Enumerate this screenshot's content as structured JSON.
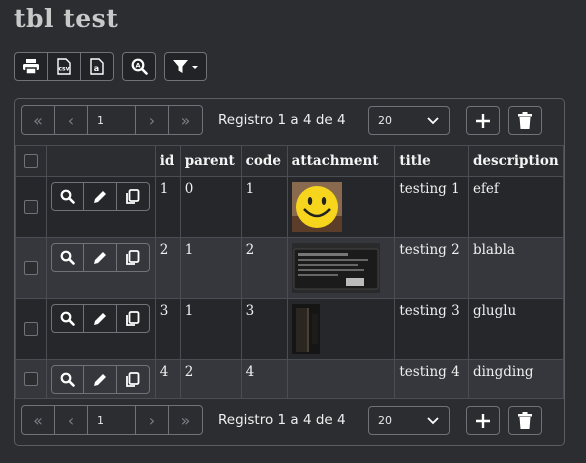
{
  "page": {
    "title": "tbl test"
  },
  "toolbar": {
    "print_icon": "printer-icon",
    "export_icons": [
      "export-csv-icon",
      "export-a-icon"
    ],
    "search_icon": "zoom-search-icon",
    "filter_icon": "filter-icon"
  },
  "pager": {
    "page": "1",
    "info": "Registro 1 a 4 de 4",
    "page_size": "20"
  },
  "table": {
    "columns": [
      "id",
      "parent",
      "code",
      "attachment",
      "title",
      "description"
    ],
    "rows": [
      {
        "id": "1",
        "parent": "0",
        "code": "1",
        "attachment": "smiley-image",
        "title": "testing 1",
        "description": "efef"
      },
      {
        "id": "2",
        "parent": "1",
        "code": "2",
        "attachment": "battery-image",
        "title": "testing 2",
        "description": "blabla"
      },
      {
        "id": "3",
        "parent": "1",
        "code": "3",
        "attachment": "dark-doorway-image",
        "title": "testing 3",
        "description": "gluglu"
      },
      {
        "id": "4",
        "parent": "2",
        "code": "4",
        "attachment": "",
        "title": "testing 4",
        "description": "dingding"
      }
    ]
  },
  "colors": {
    "background": "#2b2d31",
    "border": "#6f7277",
    "row_alt": "#35373c"
  }
}
